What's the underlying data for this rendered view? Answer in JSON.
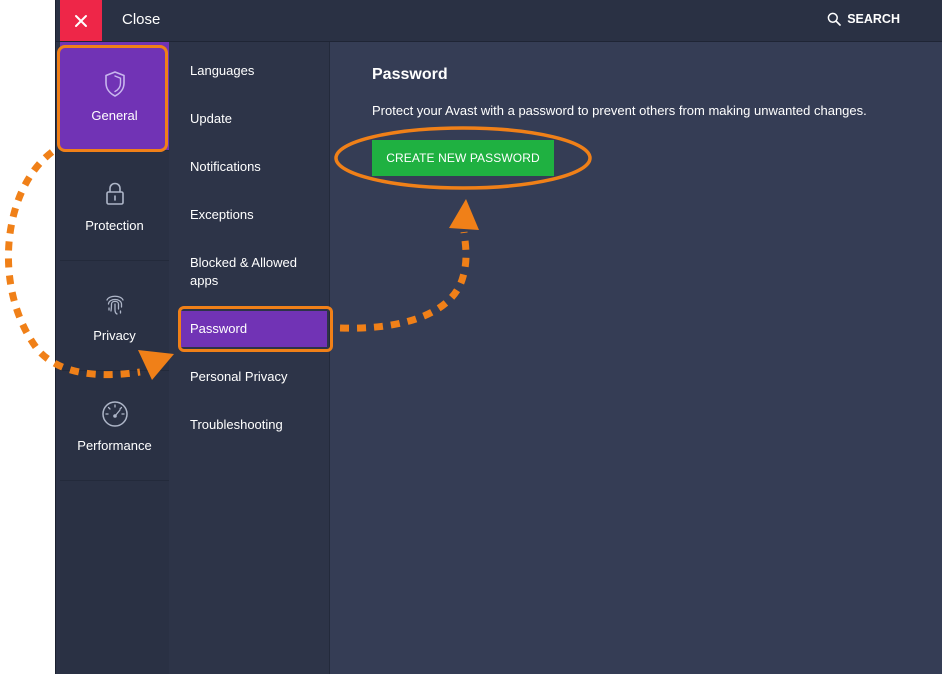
{
  "topbar": {
    "close_label": "Close",
    "search_label": "SEARCH"
  },
  "categories": [
    {
      "label": "General",
      "icon": "shield-icon",
      "active": true
    },
    {
      "label": "Protection",
      "icon": "lock-icon",
      "active": false
    },
    {
      "label": "Privacy",
      "icon": "fingerprint-icon",
      "active": false
    },
    {
      "label": "Performance",
      "icon": "speedometer-icon",
      "active": false
    }
  ],
  "submenu": [
    {
      "label": "Languages"
    },
    {
      "label": "Update"
    },
    {
      "label": "Notifications"
    },
    {
      "label": "Exceptions"
    },
    {
      "label": "Blocked & Allowed apps"
    },
    {
      "label": "Password",
      "active": true
    },
    {
      "label": "Personal Privacy"
    },
    {
      "label": "Troubleshooting"
    }
  ],
  "content": {
    "title": "Password",
    "description": "Protect your Avast with a password to prevent others from making unwanted changes.",
    "create_button": "CREATE NEW PASSWORD"
  },
  "colors": {
    "accent_purple": "#7133b5",
    "close_red": "#ee2648",
    "button_green": "#1fb141",
    "annotation_orange": "#f08018"
  }
}
